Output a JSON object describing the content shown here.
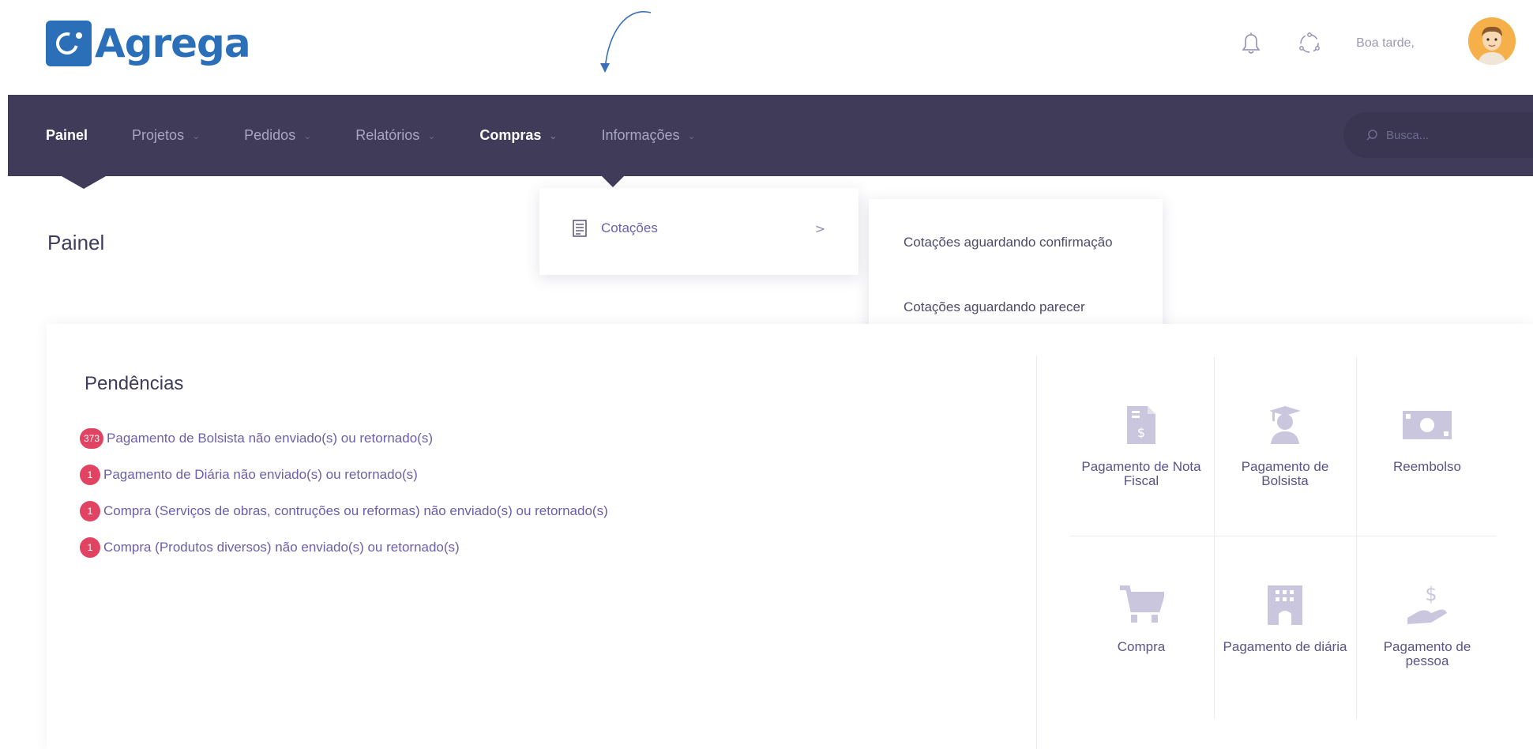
{
  "app": {
    "name": "Agrega"
  },
  "header": {
    "greeting": "Boa tarde,"
  },
  "nav": {
    "items": [
      {
        "label": "Painel",
        "active": true,
        "has_chevron": false
      },
      {
        "label": "Projetos",
        "active": false,
        "has_chevron": true
      },
      {
        "label": "Pedidos",
        "active": false,
        "has_chevron": true
      },
      {
        "label": "Relatórios",
        "active": false,
        "has_chevron": true
      },
      {
        "label": "Compras",
        "active": false,
        "has_chevron": true,
        "open": true
      },
      {
        "label": "Informações",
        "active": false,
        "has_chevron": true
      }
    ],
    "search_placeholder": "Busca..."
  },
  "dropdown": {
    "item": {
      "label": "Cotações",
      "icon": "document-icon",
      "chevron": ">"
    },
    "submenu": [
      "Cotações aguardando confirmação",
      "Cotações aguardando parecer"
    ]
  },
  "page": {
    "title": "Painel"
  },
  "pendencias": {
    "title": "Pendências",
    "items": [
      {
        "count": "373",
        "text": "Pagamento de Bolsista não enviado(s) ou retornado(s)"
      },
      {
        "count": "1",
        "text": "Pagamento de Diária não enviado(s) ou retornado(s)"
      },
      {
        "count": "1",
        "text": "Compra (Serviços de obras, contruções ou reformas) não enviado(s) ou retornado(s)"
      },
      {
        "count": "1",
        "text": "Compra (Produtos diversos) não enviado(s) ou retornado(s)"
      }
    ]
  },
  "tiles": [
    {
      "label": "Pagamento de Nota Fiscal",
      "icon": "invoice-icon"
    },
    {
      "label": "Pagamento de Bolsista",
      "icon": "graduate-icon"
    },
    {
      "label": "Reembolso",
      "icon": "money-bill-icon"
    },
    {
      "label": "Compra",
      "icon": "cart-icon"
    },
    {
      "label": "Pagamento de diária",
      "icon": "building-icon"
    },
    {
      "label": "Pagamento de pessoa",
      "icon": "hand-money-icon"
    }
  ],
  "colors": {
    "brand": "#2a6fb8",
    "nav_bg": "#3f3b59",
    "badge": "#e04462",
    "link": "#6b5fa8",
    "icon": "#c9c6de"
  }
}
